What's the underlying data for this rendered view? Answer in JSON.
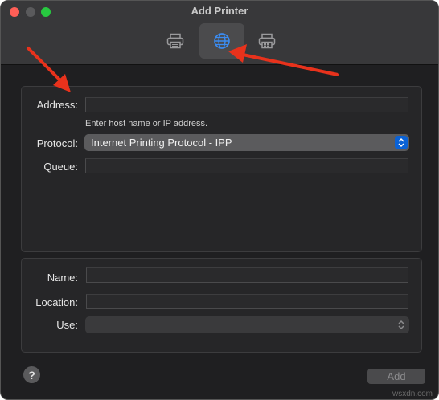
{
  "window": {
    "title": "Add Printer",
    "toolbar": [
      {
        "id": "default",
        "icon": "printer-icon",
        "active": false
      },
      {
        "id": "ip",
        "icon": "globe-icon",
        "active": true
      },
      {
        "id": "windows",
        "icon": "windows-printer-icon",
        "active": false
      }
    ]
  },
  "form": {
    "address_label": "Address:",
    "address_value": "",
    "address_hint": "Enter host name or IP address.",
    "protocol_label": "Protocol:",
    "protocol_value": "Internet Printing Protocol - IPP",
    "queue_label": "Queue:",
    "queue_value": "",
    "name_label": "Name:",
    "name_value": "",
    "location_label": "Location:",
    "location_value": "",
    "use_label": "Use:",
    "use_value": ""
  },
  "footer": {
    "help_label": "?",
    "add_label": "Add"
  },
  "annotations": {
    "arrow_color": "#e8321c"
  },
  "watermark": "wsxdn.com"
}
